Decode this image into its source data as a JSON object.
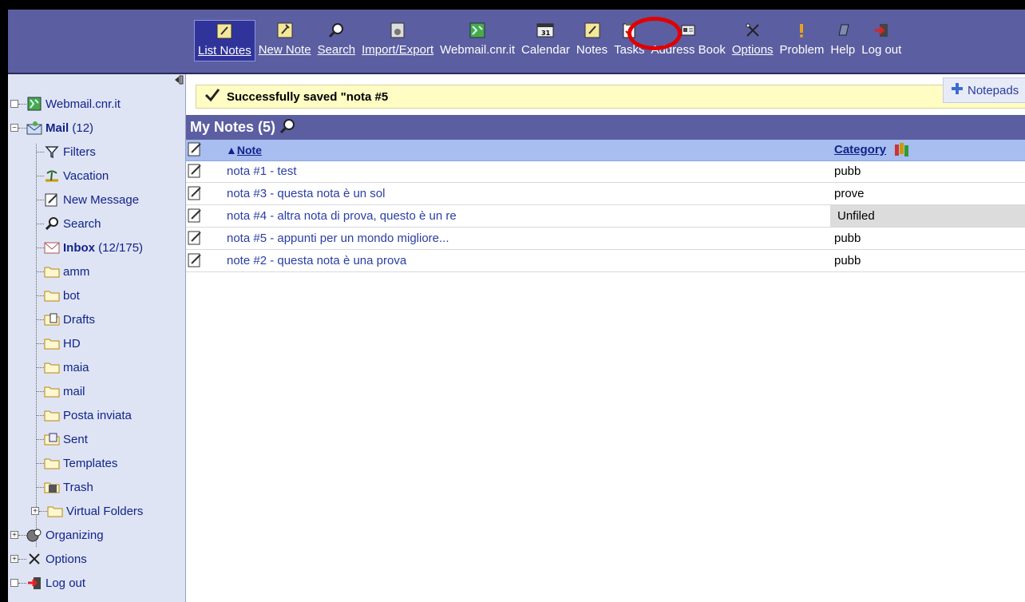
{
  "toolbar": {
    "items": [
      {
        "label": "List Notes",
        "icon": "list-notes-icon"
      },
      {
        "label": "New Note",
        "icon": "new-note-icon"
      },
      {
        "label": "Search",
        "icon": "search-icon"
      },
      {
        "label": "Import/Export",
        "icon": "import-export-icon"
      },
      {
        "label": "Webmail.cnr.it",
        "icon": "webmail-icon"
      },
      {
        "label": "Calendar",
        "icon": "calendar-icon"
      },
      {
        "label": "Notes",
        "icon": "notes-icon"
      },
      {
        "label": "Tasks",
        "icon": "tasks-icon"
      },
      {
        "label": "Address Book",
        "icon": "address-book-icon"
      },
      {
        "label": "Options",
        "icon": "options-icon"
      },
      {
        "label": "Problem",
        "icon": "problem-icon"
      },
      {
        "label": "Help",
        "icon": "help-icon"
      },
      {
        "label": "Log out",
        "icon": "logout-icon"
      }
    ],
    "calendar_day": "31"
  },
  "sidebar": {
    "webmail": "Webmail.cnr.it",
    "mail": "Mail",
    "mail_count": "(12)",
    "filters": "Filters",
    "vacation": "Vacation",
    "new_message": "New Message",
    "search": "Search",
    "inbox": "Inbox",
    "inbox_count": "(12/175)",
    "folders": [
      "amm",
      "bot",
      "Drafts",
      "HD",
      "maia",
      "mail",
      "Posta inviata",
      "Sent",
      "Templates",
      "Trash",
      "Virtual Folders"
    ],
    "organizing": "Organizing",
    "options": "Options",
    "logout": "Log out"
  },
  "notice": {
    "message": "Successfully saved \"nota #5"
  },
  "notepads_button": "Notepads",
  "list": {
    "title": "My Notes (5)",
    "col_note": "Note",
    "col_note_sort": "▲",
    "col_category": "Category",
    "rows": [
      {
        "note": "nota #1 - test",
        "category": "pubb"
      },
      {
        "note": "nota #3 - questa nota è un sol",
        "category": "prove"
      },
      {
        "note": "nota #4 - altra nota di prova, questo è un re",
        "category": "Unfiled"
      },
      {
        "note": "nota #5 - appunti per un mondo migliore...",
        "category": "pubb"
      },
      {
        "note": "note #2 - questa nota è una prova",
        "category": "pubb"
      }
    ]
  },
  "colors": {
    "toolbar_bg": "#5b5ea0",
    "sidebar_bg": "#dfe4f4",
    "link": "#2a3ea3",
    "highlight_circle": "#e00000"
  }
}
